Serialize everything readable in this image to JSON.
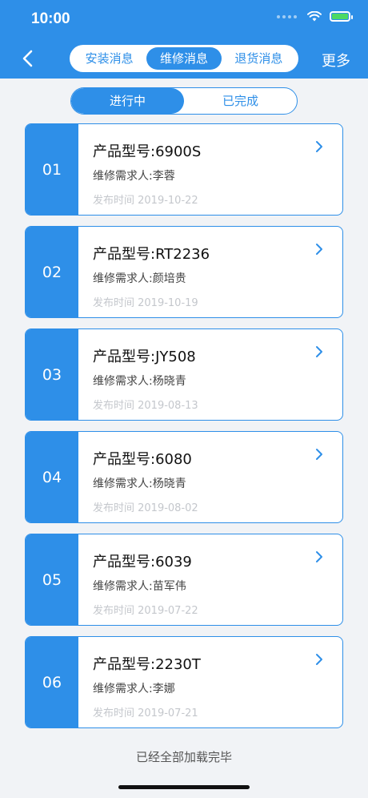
{
  "status_bar": {
    "time": "10:00"
  },
  "header": {
    "tabs": [
      {
        "label": "安装消息",
        "active": false
      },
      {
        "label": "维修消息",
        "active": true
      },
      {
        "label": "退货消息",
        "active": false
      }
    ],
    "more_label": "更多"
  },
  "status_tabs": [
    {
      "label": "进行中",
      "active": true
    },
    {
      "label": "已完成",
      "active": false
    }
  ],
  "items": [
    {
      "index": "01",
      "model": "产品型号:6900S",
      "requester": "维修需求人:李蓉",
      "time": "发布时间 2019-10-22"
    },
    {
      "index": "02",
      "model": "产品型号:RT2236",
      "requester": "维修需求人:颜培贵",
      "time": "发布时间 2019-10-19"
    },
    {
      "index": "03",
      "model": "产品型号:JY508",
      "requester": "维修需求人:杨晓青",
      "time": "发布时间 2019-08-13"
    },
    {
      "index": "04",
      "model": "产品型号:6080",
      "requester": "维修需求人:杨晓青",
      "time": "发布时间 2019-08-02"
    },
    {
      "index": "05",
      "model": "产品型号:6039",
      "requester": "维修需求人:苗军伟",
      "time": "发布时间 2019-07-22"
    },
    {
      "index": "06",
      "model": "产品型号:2230T",
      "requester": "维修需求人:李娜",
      "time": "发布时间 2019-07-21"
    }
  ],
  "footer": "已经全部加载完毕",
  "colors": {
    "accent": "#2e8fe8",
    "background": "#f1f3f6"
  },
  "icons": {
    "back": "chevron-left-icon",
    "row": "chevron-right-icon",
    "wifi": "wifi-icon",
    "battery": "battery-charging-icon"
  }
}
